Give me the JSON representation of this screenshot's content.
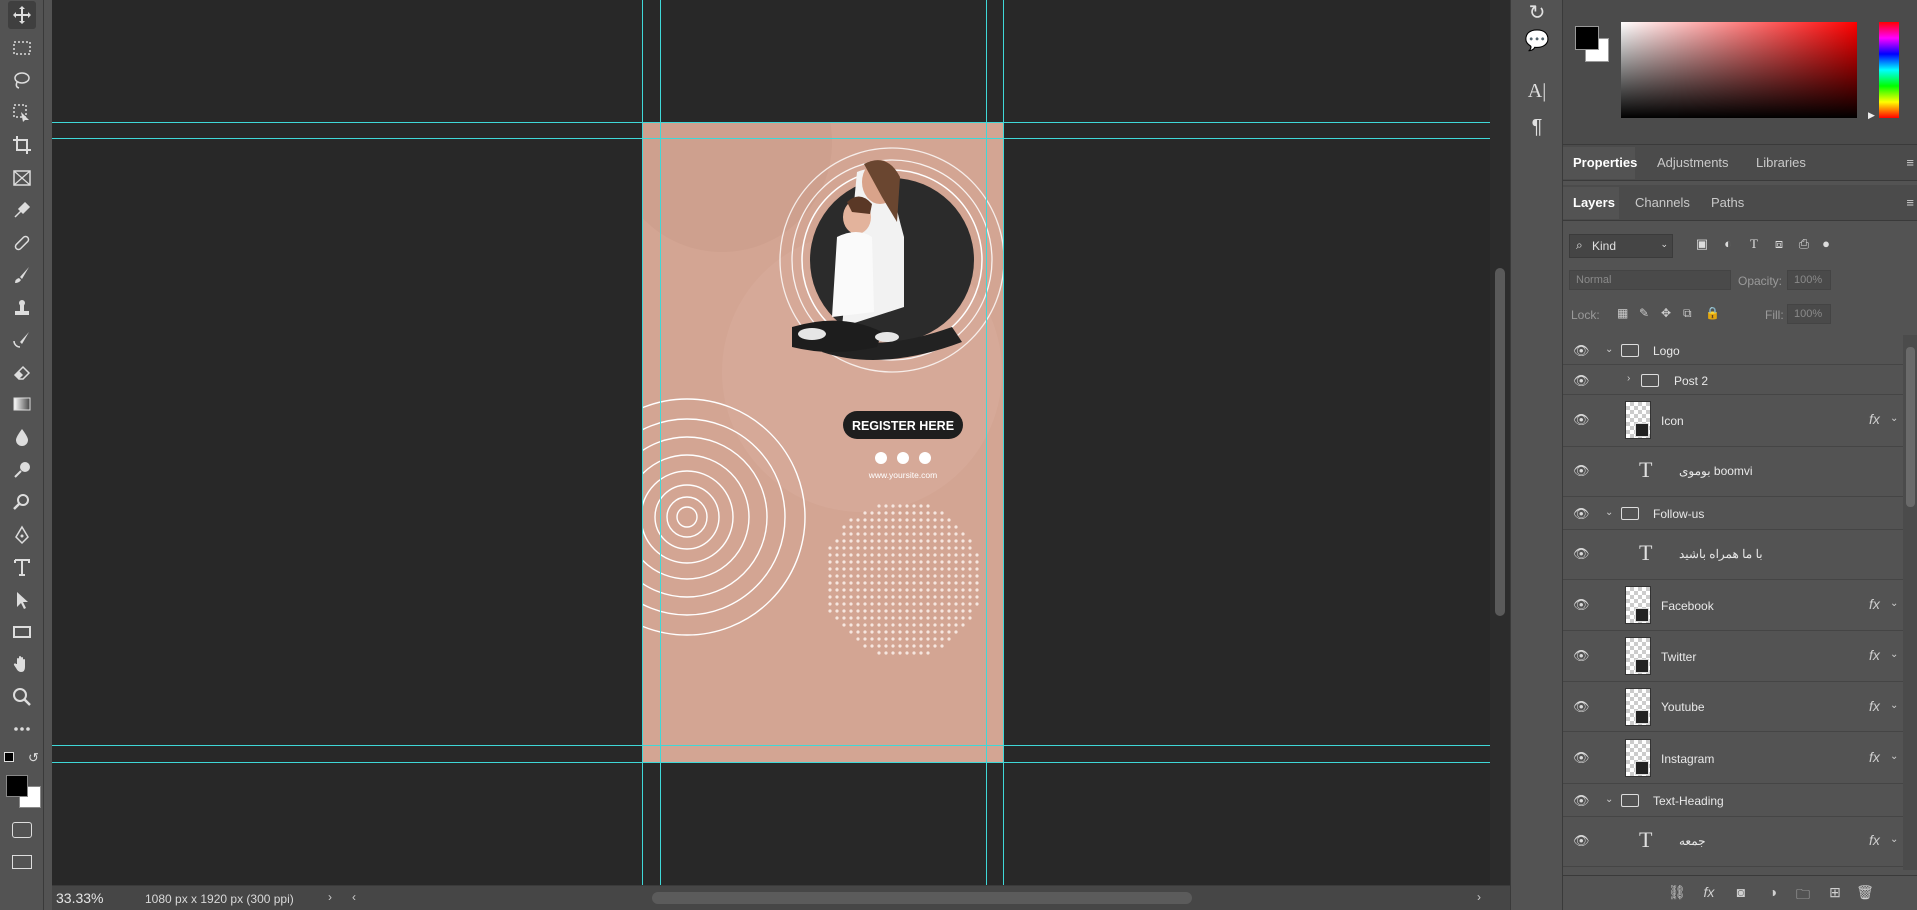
{
  "toolbar": {
    "tools": [
      {
        "name": "move-icon"
      },
      {
        "name": "marquee-icon"
      },
      {
        "name": "lasso-icon"
      },
      {
        "name": "object-select-icon"
      },
      {
        "name": "crop-icon"
      },
      {
        "name": "frame-icon"
      },
      {
        "name": "eyedropper-icon"
      },
      {
        "name": "healing-icon"
      },
      {
        "name": "brush-icon"
      },
      {
        "name": "stamp-icon"
      },
      {
        "name": "history-brush-icon"
      },
      {
        "name": "eraser-icon"
      },
      {
        "name": "gradient-icon"
      },
      {
        "name": "blur-icon"
      },
      {
        "name": "dodge-icon"
      },
      {
        "name": "zoom-lens-icon"
      },
      {
        "name": "pen-icon"
      },
      {
        "name": "type-icon"
      },
      {
        "name": "path-select-icon"
      },
      {
        "name": "rectangle-icon"
      },
      {
        "name": "hand-icon"
      },
      {
        "name": "zoom-icon"
      },
      {
        "name": "more-tools-icon"
      }
    ],
    "foreground_color": "#000000",
    "background_color": "#ffffff"
  },
  "document": {
    "background_color": "#d3a593",
    "register_label": "REGISTER HERE",
    "website": "www.yoursite.com"
  },
  "status": {
    "zoom": "33.33%",
    "doc_info": "1080 px x 1920 px (300 ppi)"
  },
  "panels": {
    "properties_tabs": [
      "Properties",
      "Adjustments",
      "Libraries"
    ],
    "layer_tabs": [
      "Layers",
      "Channels",
      "Paths"
    ],
    "kind_label": "Kind",
    "blend_mode": "Normal",
    "opacity_label": "Opacity:",
    "opacity_value": "100%",
    "lock_label": "Lock:",
    "fill_label": "Fill:",
    "fill_value": "100%"
  },
  "layers": [
    {
      "name": "Logo",
      "type": "group",
      "expanded": true
    },
    {
      "name": "Post 2",
      "type": "group",
      "expanded": false
    },
    {
      "name": "Icon",
      "type": "smart",
      "fx": true
    },
    {
      "name": "بوموی boomvi",
      "type": "text",
      "fx": false
    },
    {
      "name": "Follow-us",
      "type": "group",
      "expanded": true
    },
    {
      "name": "با ما همراه باشید",
      "type": "text",
      "fx": false
    },
    {
      "name": "Facebook",
      "type": "smart",
      "fx": true
    },
    {
      "name": "Twitter",
      "type": "smart",
      "fx": true
    },
    {
      "name": "Youtube",
      "type": "smart",
      "fx": true
    },
    {
      "name": "Instagram",
      "type": "smart",
      "fx": true
    },
    {
      "name": "Text-Heading",
      "type": "group",
      "expanded": true
    },
    {
      "name": "جمعه",
      "type": "text",
      "fx": true
    }
  ],
  "labels": {
    "fx": "fx"
  }
}
